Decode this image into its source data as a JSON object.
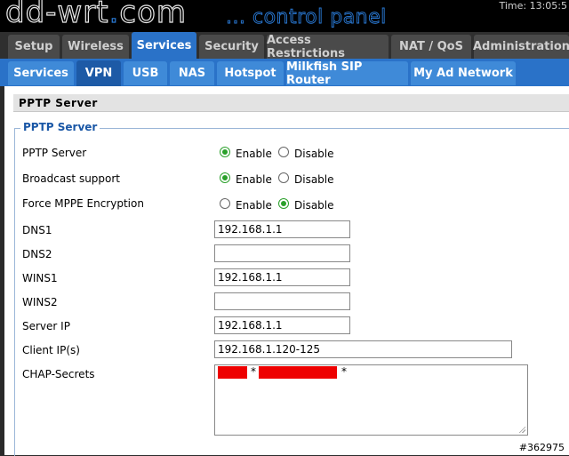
{
  "header": {
    "logo_main": "dd-wrt",
    "logo_dot": ".",
    "logo_com": "com",
    "tagline": "... control panel",
    "time": "Time: 13:05:5"
  },
  "main_tabs": [
    {
      "label": "Setup",
      "active": false
    },
    {
      "label": "Wireless",
      "active": false
    },
    {
      "label": "Services",
      "active": true
    },
    {
      "label": "Security",
      "active": false
    },
    {
      "label": "Access Restrictions",
      "active": false
    },
    {
      "label": "NAT / QoS",
      "active": false
    },
    {
      "label": "Administration",
      "active": false
    }
  ],
  "sub_tabs": [
    {
      "label": "Services",
      "active": false
    },
    {
      "label": "VPN",
      "active": true
    },
    {
      "label": "USB",
      "active": false
    },
    {
      "label": "NAS",
      "active": false
    },
    {
      "label": "Hotspot",
      "active": false
    },
    {
      "label": "Milkfish SIP Router",
      "active": false
    },
    {
      "label": "My Ad Network",
      "active": false
    }
  ],
  "section": {
    "title": "PPTP Server",
    "legend": "PPTP Server"
  },
  "options": {
    "enable": "Enable",
    "disable": "Disable"
  },
  "radio_rows": [
    {
      "label": "PPTP Server",
      "value": "enable"
    },
    {
      "label": "Broadcast support",
      "value": "enable"
    },
    {
      "label": "Force MPPE Encryption",
      "value": "disable"
    }
  ],
  "fields": {
    "dns1": {
      "label": "DNS1",
      "value": "192.168.1.1"
    },
    "dns2": {
      "label": "DNS2",
      "value": ""
    },
    "wins1": {
      "label": "WINS1",
      "value": "192.168.1.1"
    },
    "wins2": {
      "label": "WINS2",
      "value": ""
    },
    "server_ip": {
      "label": "Server IP",
      "value": "192.168.1.1"
    },
    "client_ips": {
      "label": "Client IP(s)",
      "value": "192.168.1.120-125"
    },
    "chap": {
      "label": "CHAP-Secrets",
      "sep1": "*",
      "sep2": "*"
    }
  },
  "watermark": "#362975",
  "colors": {
    "accent": "#2a72c8",
    "radio_on": "#2aa02a",
    "redaction": "#e00000",
    "legend": "#1a57a6"
  }
}
